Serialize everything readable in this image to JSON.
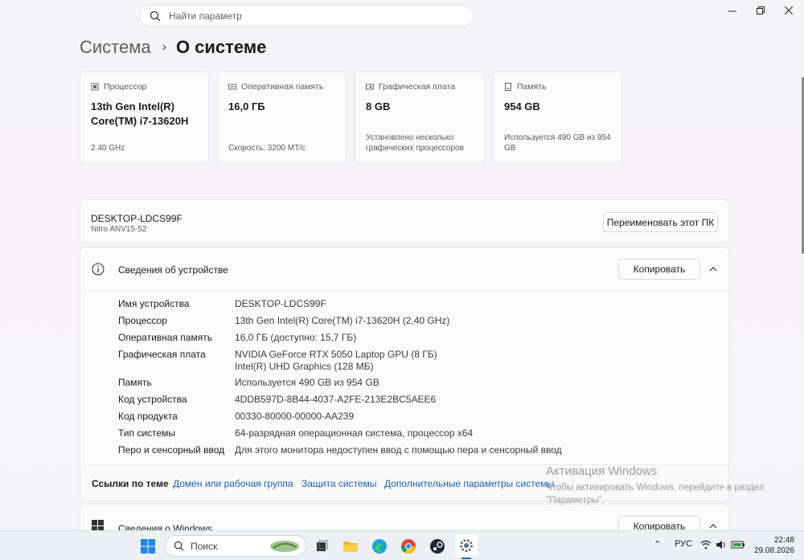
{
  "search": {
    "placeholder": "Найти параметр"
  },
  "breadcrumb": {
    "parent": "Система",
    "current": "О системе"
  },
  "cards": [
    {
      "label": "Процессор",
      "value": "13th Gen Intel(R) Core(TM) i7-13620H",
      "sub": "2.40 GHz",
      "icon": "cpu-icon"
    },
    {
      "label": "Оперативная память",
      "value": "16,0 ГБ",
      "sub": "Скорость: 3200 МТ/с",
      "icon": "ram-icon"
    },
    {
      "label": "Графическая плата",
      "value": "8 GB",
      "sub": "Установлено несколько графических процессоров",
      "icon": "gpu-icon"
    },
    {
      "label": "Память",
      "value": "954 GB",
      "sub": "Используется 490 GB из 954 GB",
      "icon": "storage-icon"
    }
  ],
  "pc": {
    "name": "DESKTOP-LDCS99F",
    "model": "Nitro ANV15-52",
    "rename_label": "Переименовать этот ПК"
  },
  "device": {
    "title": "Сведения об устройстве",
    "copy_label": "Копировать",
    "specs": [
      {
        "key": "Имя устройства",
        "value": "DESKTOP-LDCS99F"
      },
      {
        "key": "Процессор",
        "value": "13th Gen Intel(R) Core(TM) i7-13620H (2,40 GHz)"
      },
      {
        "key": "Оперативная память",
        "value": "16,0 ГБ (доступно: 15,7 ГБ)"
      },
      {
        "key": "Графическая плата",
        "value": "NVIDIA GeForce RTX 5050 Laptop GPU (8 ГБ)",
        "value2": "Intel(R) UHD Graphics (128 МБ)"
      },
      {
        "key": "Память",
        "value": "Используется 490 GB из 954 GB"
      },
      {
        "key": "Код устройства",
        "value": "4DDB597D-8B44-4037-A2FE-213E2BC5AEE6"
      },
      {
        "key": "Код продукта",
        "value": "00330-80000-00000-AA239"
      },
      {
        "key": "Тип системы",
        "value": "64-разрядная операционная система, процессор x64"
      },
      {
        "key": "Перо и сенсорный ввод",
        "value": "Для этого монитора недоступен ввод с помощью пера и сенсорный ввод"
      }
    ],
    "related_title": "Ссылки по теме",
    "related_links": [
      "Домен или рабочая группа",
      "Защита системы",
      "Дополнительные параметры системы"
    ]
  },
  "windows": {
    "title": "Сведения о Windows",
    "copy_label": "Копировать"
  },
  "activation": {
    "heading": "Активация Windows",
    "line1": "Чтобы активировать Windows, перейдите в раздел",
    "line2": "\"Параметры\"."
  },
  "taskbar": {
    "search_label": "Поиск",
    "lang": "РУС",
    "time": "22:48",
    "date": "29.08.2026"
  },
  "colors": {
    "accent": "#1a5fb4",
    "background": "#f4f4f8"
  }
}
